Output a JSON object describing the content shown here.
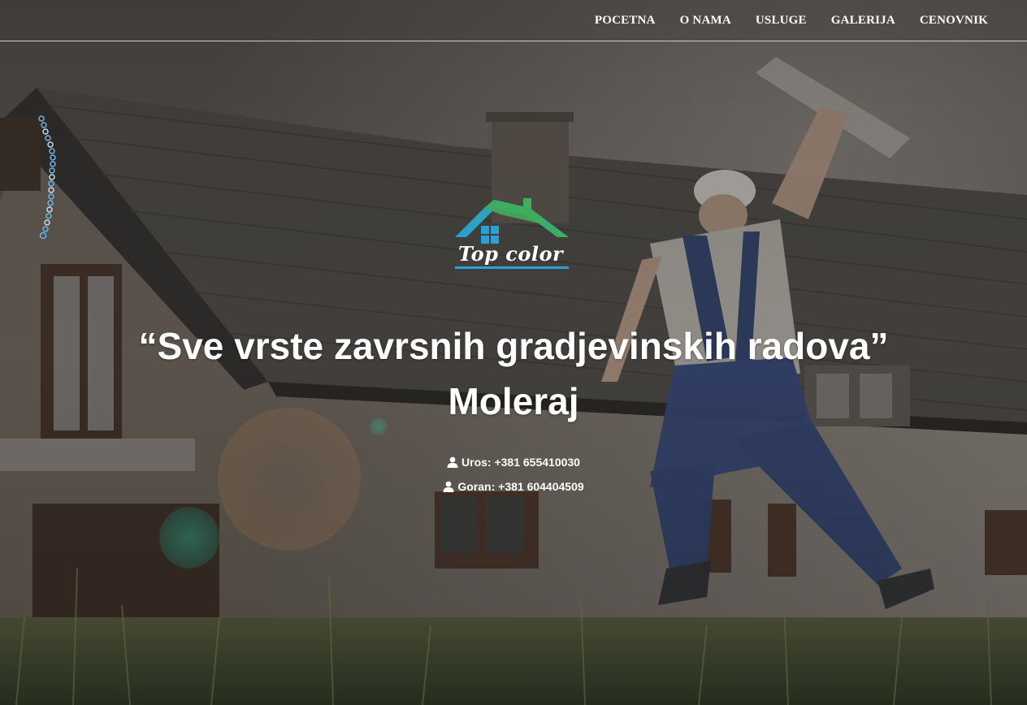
{
  "nav": {
    "items": [
      "POCETNA",
      "O NAMA",
      "USLUGE",
      "GALERIJA",
      "CENOVNIK"
    ]
  },
  "logo": {
    "text": "Top color",
    "icon": "house-roof-icon"
  },
  "hero": {
    "headline_line1": "“Sve vrste zavrsnih gradjevinskih radova”",
    "headline_line2": "Moleraj",
    "contacts": [
      {
        "icon": "user-icon",
        "text": "Uros: +381 655410030"
      },
      {
        "icon": "user-icon",
        "text": "Goran: +381 604404509"
      }
    ]
  },
  "colors": {
    "logo_blue": "#2a9fd8",
    "logo_green": "#3fae5a",
    "text": "#ffffff"
  }
}
